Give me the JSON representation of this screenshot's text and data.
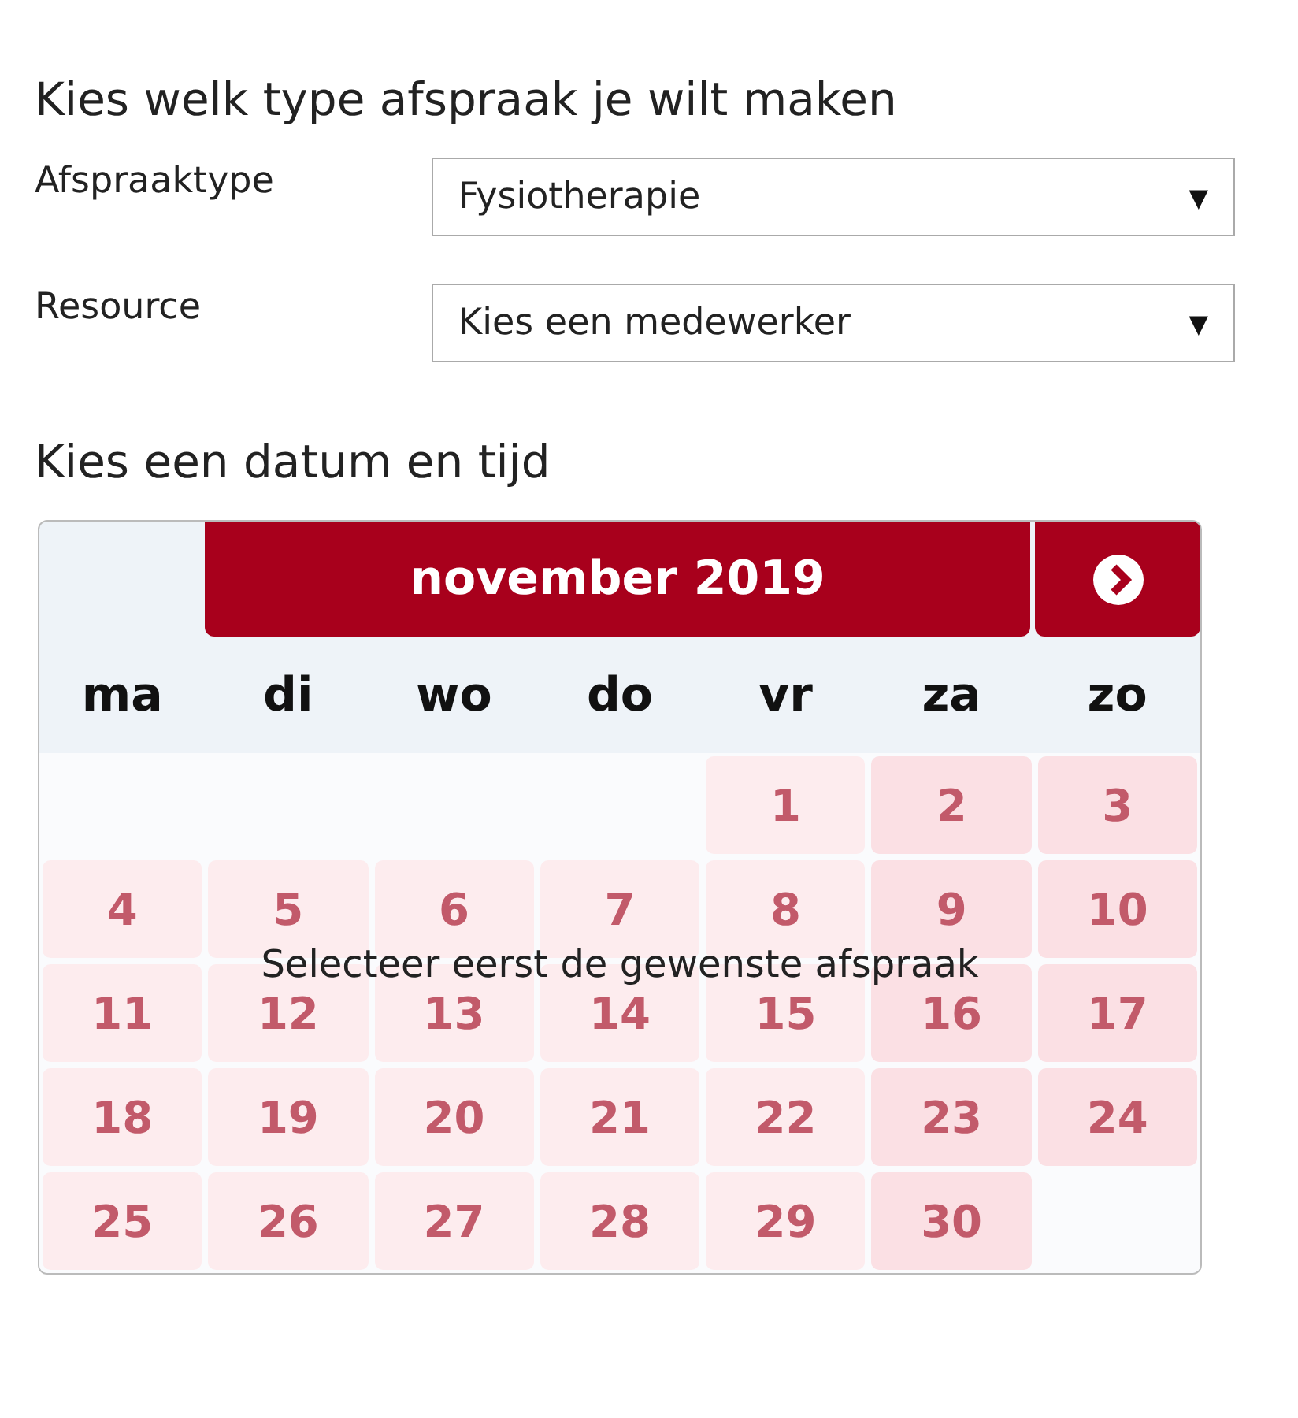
{
  "type_heading": "Kies welk type afspraak je wilt maken",
  "fields": [
    {
      "label": "Afspraaktype",
      "value": "Fysiotherapie",
      "caret": "▼"
    },
    {
      "label": "Resource",
      "value": "Kies een medewerker",
      "caret": "▼"
    }
  ],
  "date_heading": "Kies een datum en tijd",
  "calendar": {
    "month": "november 2019",
    "weekdays": [
      "ma",
      "di",
      "wo",
      "do",
      "vr",
      "za",
      "zo"
    ],
    "days": [
      {
        "day": "1",
        "kind": "weekday"
      },
      {
        "day": "2",
        "kind": "weekend"
      },
      {
        "day": "3",
        "kind": "weekend"
      },
      {
        "day": "4",
        "kind": "weekday"
      },
      {
        "day": "5",
        "kind": "weekday"
      },
      {
        "day": "6",
        "kind": "weekday"
      },
      {
        "day": "7",
        "kind": "weekday"
      },
      {
        "day": "8",
        "kind": "weekday"
      },
      {
        "day": "9",
        "kind": "weekend"
      },
      {
        "day": "10",
        "kind": "weekend"
      },
      {
        "day": "11",
        "kind": "weekday"
      },
      {
        "day": "12",
        "kind": "weekday"
      },
      {
        "day": "13",
        "kind": "weekday"
      },
      {
        "day": "14",
        "kind": "weekday"
      },
      {
        "day": "15",
        "kind": "weekday"
      },
      {
        "day": "16",
        "kind": "weekend"
      },
      {
        "day": "17",
        "kind": "weekend"
      },
      {
        "day": "18",
        "kind": "weekday"
      },
      {
        "day": "19",
        "kind": "weekday"
      },
      {
        "day": "20",
        "kind": "weekday"
      },
      {
        "day": "21",
        "kind": "weekday"
      },
      {
        "day": "22",
        "kind": "weekday"
      },
      {
        "day": "23",
        "kind": "weekend"
      },
      {
        "day": "24",
        "kind": "weekend"
      },
      {
        "day": "25",
        "kind": "weekday"
      },
      {
        "day": "26",
        "kind": "weekday"
      },
      {
        "day": "27",
        "kind": "weekday"
      },
      {
        "day": "28",
        "kind": "weekday"
      },
      {
        "day": "29",
        "kind": "weekday"
      },
      {
        "day": "30",
        "kind": "weekend"
      }
    ],
    "message": "Selecteer eerst de gewenste afspraak"
  }
}
